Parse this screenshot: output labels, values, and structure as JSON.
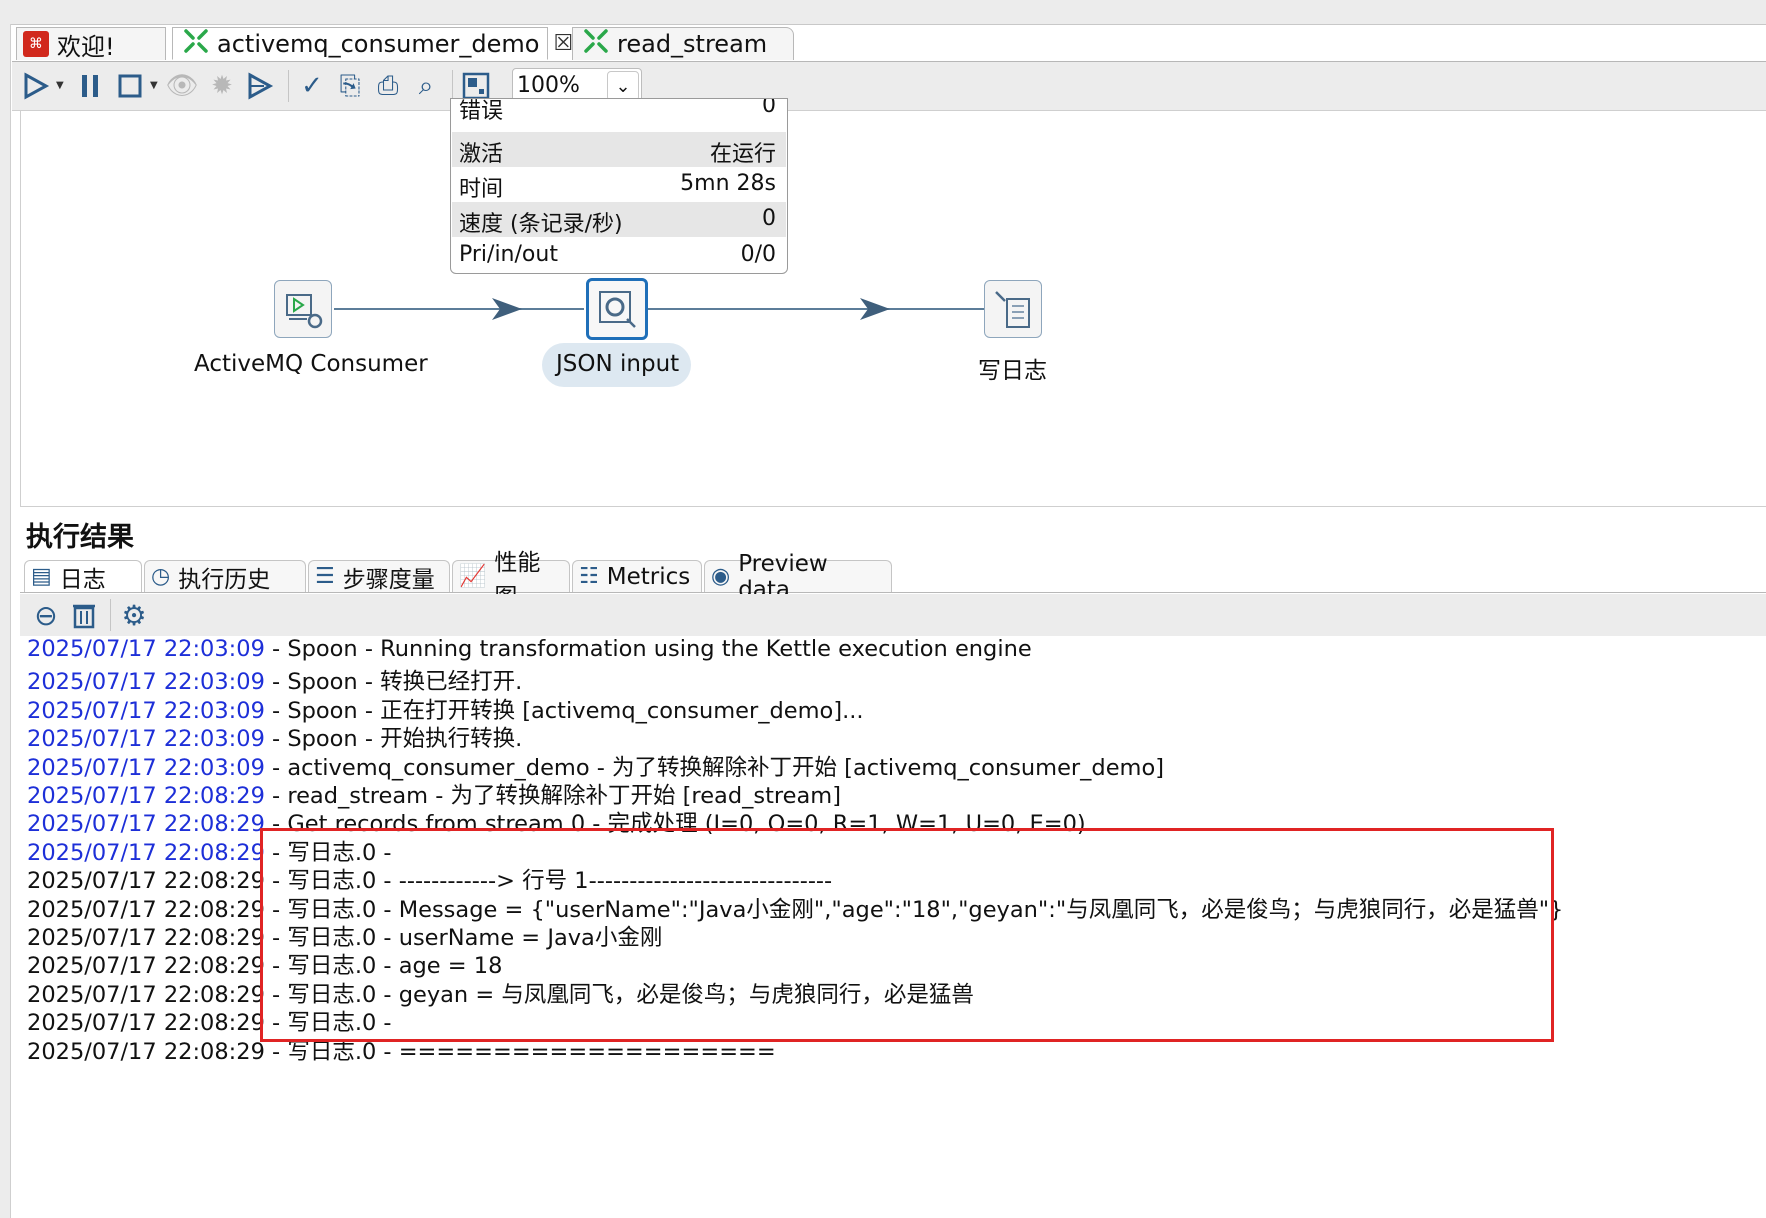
{
  "tabs": [
    {
      "label": "欢迎!",
      "icon": "welcome-logo-icon"
    },
    {
      "label": "activemq_consumer_demo",
      "icon": "transformation-icon",
      "close": "☒"
    },
    {
      "label": "read_stream",
      "icon": "transformation-icon"
    }
  ],
  "toolbar": {
    "zoom_value": "100%",
    "icons": [
      "run-icon",
      "pause-icon",
      "stop-icon",
      "preview-icon",
      "debug-icon",
      "replay-icon",
      "verify-icon",
      "impact-icon",
      "sql-icon",
      "explore-db-icon",
      "show-results-icon"
    ]
  },
  "step_stats": {
    "rows": [
      {
        "key": "错误",
        "value": "0"
      },
      {
        "key": "激活",
        "value": "在运行"
      },
      {
        "key": "时间",
        "value": "5mn 28s"
      },
      {
        "key": "速度 (条记录/秒)",
        "value": "0"
      },
      {
        "key": "Pri/in/out",
        "value": "0/0"
      }
    ]
  },
  "steps": [
    {
      "label": "ActiveMQ Consumer"
    },
    {
      "label": "JSON input"
    },
    {
      "label": "写日志"
    }
  ],
  "results": {
    "title": "执行结果",
    "tabs": [
      {
        "label": "日志",
        "icon": "log-icon"
      },
      {
        "label": "执行历史",
        "icon": "history-icon"
      },
      {
        "label": "步骤度量",
        "icon": "step-metrics-icon"
      },
      {
        "label": "性能图",
        "icon": "performance-chart-icon"
      },
      {
        "label": "Metrics",
        "icon": "metrics-icon"
      },
      {
        "label": "Preview data",
        "icon": "preview-eye-icon"
      }
    ],
    "log_tools": [
      "clear-log-icon",
      "trash-icon",
      "settings-gear-icon"
    ]
  },
  "log": [
    {
      "ts": "2025/07/17 22:03:09",
      "msg": " - Spoon - Running transformation using the Kettle execution engine",
      "ts_color": "blue"
    },
    {
      "ts": "2025/07/17 22:03:09",
      "msg": " - Spoon - 转换已经打开.",
      "ts_color": "blue"
    },
    {
      "ts": "2025/07/17 22:03:09",
      "msg": " - Spoon - 正在打开转换 [activemq_consumer_demo]...",
      "ts_color": "blue"
    },
    {
      "ts": "2025/07/17 22:03:09",
      "msg": " - Spoon - 开始执行转换.",
      "ts_color": "blue"
    },
    {
      "ts": "2025/07/17 22:03:09",
      "msg": " - activemq_consumer_demo - 为了转换解除补丁开始  [activemq_consumer_demo]",
      "ts_color": "blue"
    },
    {
      "ts": "2025/07/17 22:08:29",
      "msg": " - read_stream - 为了转换解除补丁开始  [read_stream]",
      "ts_color": "blue"
    },
    {
      "ts": "2025/07/17 22:08:29",
      "msg": " - Get records from stream.0 - 完成处理 (I=0, O=0, R=1, W=1, U=0, E=0)",
      "ts_color": "blue"
    },
    {
      "ts": "2025/07/17 22:08:29",
      "msg": " - 写日志.0 - ",
      "ts_color": "blue"
    },
    {
      "ts": "2025/07/17 22:08:29",
      "msg": " - 写日志.0 - ------------> 行号 1------------------------------",
      "ts_color": "black"
    },
    {
      "ts": "2025/07/17 22:08:29",
      "msg": " - 写日志.0 - Message = {\"userName\":\"Java小金刚\",\"age\":\"18\",\"geyan\":\"与凤凰同飞，必是俊鸟；与虎狼同行，必是猛兽\"}",
      "ts_color": "black"
    },
    {
      "ts": "2025/07/17 22:08:29",
      "msg": " - 写日志.0 - userName = Java小金刚",
      "ts_color": "black"
    },
    {
      "ts": "2025/07/17 22:08:29",
      "msg": " - 写日志.0 - age = 18",
      "ts_color": "black"
    },
    {
      "ts": "2025/07/17 22:08:29",
      "msg": " - 写日志.0 - geyan = 与凤凰同飞，必是俊鸟；与虎狼同行，必是猛兽",
      "ts_color": "black"
    },
    {
      "ts": "2025/07/17 22:08:29",
      "msg": " - 写日志.0 - ",
      "ts_color": "black"
    },
    {
      "ts": "2025/07/17 22:08:29",
      "msg": " - 写日志.0 - ====================",
      "ts_color": "black"
    }
  ],
  "colors": {
    "timestamp_blue": "#1d2fd8",
    "highlight_red": "#e02424",
    "selected_step": "#1f6fb8"
  }
}
